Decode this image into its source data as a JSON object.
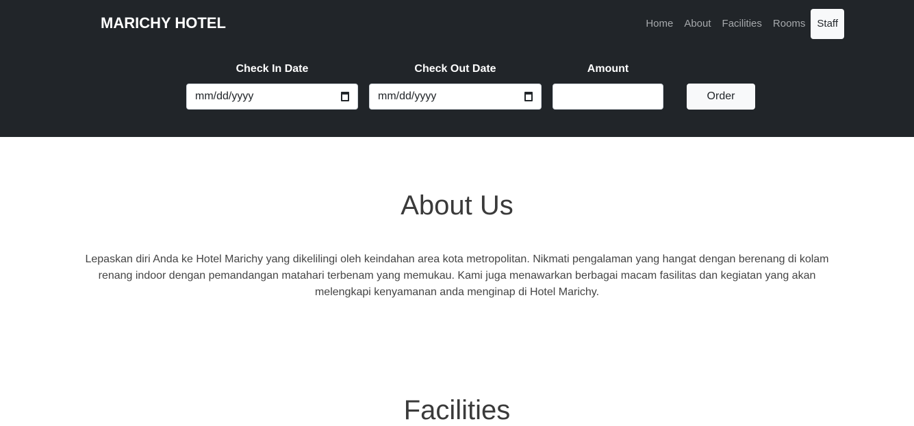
{
  "header": {
    "brand": "MARICHY HOTEL",
    "nav": [
      "Home",
      "About",
      "Facilities",
      "Rooms",
      "Staff"
    ],
    "active_nav": "Staff"
  },
  "booking": {
    "checkin_label": "Check In Date",
    "checkin_placeholder": "mm/dd/yyyy",
    "checkout_label": "Check Out Date",
    "checkout_placeholder": "mm/dd/yyyy",
    "amount_label": "Amount",
    "amount_value": "",
    "order_label": "Order"
  },
  "about": {
    "title": "About Us",
    "text": "Lepaskan diri Anda ke Hotel Marichy yang dikelilingi oleh keindahan area kota metropolitan. Nikmati pengalaman yang hangat dengan berenang di kolam renang indoor dengan pemandangan matahari terbenam yang memukau. Kami juga menawarkan berbagai macam fasilitas dan kegiatan yang akan melengkapi kenyamanan anda menginap di Hotel Marichy."
  },
  "facilities": {
    "title": "Facilities"
  }
}
